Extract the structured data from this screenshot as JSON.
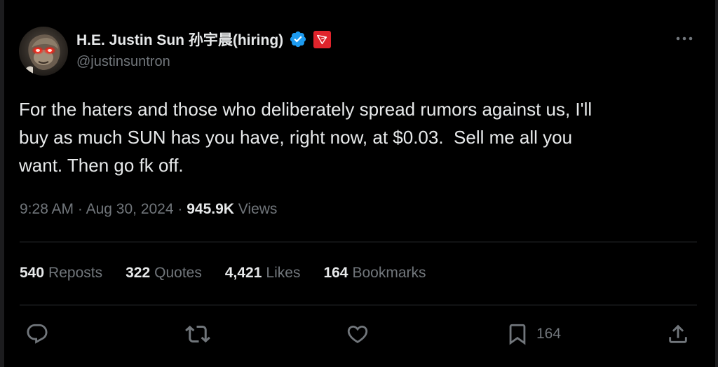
{
  "author": {
    "display_name": "H.E. Justin Sun 孙宇晨(hiring)",
    "handle": "@justinsuntron",
    "verified_icon": "verified-badge-icon",
    "affiliate_icon": "tron-logo-icon"
  },
  "tweet": {
    "text": "For the haters and those who deliberately spread rumors against us, I'll\nbuy as much SUN has you have, right now, at $0.03.  Sell me all you\nwant. Then go fk off."
  },
  "meta": {
    "time": "9:28 AM",
    "separator": "·",
    "date": "Aug 30, 2024",
    "views_count": "945.9K",
    "views_label": "Views"
  },
  "stats": [
    {
      "count": "540",
      "label": "Reposts"
    },
    {
      "count": "322",
      "label": "Quotes"
    },
    {
      "count": "4,421",
      "label": "Likes"
    },
    {
      "count": "164",
      "label": "Bookmarks"
    }
  ],
  "actions": {
    "reply_icon": "reply-icon",
    "repost_icon": "repost-icon",
    "like_icon": "heart-icon",
    "bookmark_icon": "bookmark-icon",
    "bookmark_count": "164",
    "share_icon": "share-icon"
  },
  "colors": {
    "background": "#000000",
    "text_primary": "#e7e9ea",
    "text_secondary": "#71767b",
    "verified_blue": "#1d9bf0",
    "tron_red": "#e0242c",
    "divider": "#2f3336"
  }
}
